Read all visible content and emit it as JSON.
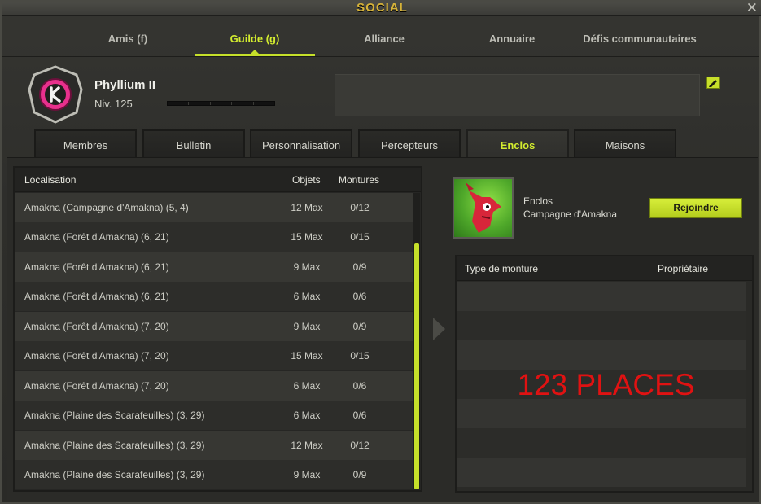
{
  "window": {
    "title": "SOCIAL",
    "close_label": "✕"
  },
  "top_tabs": [
    {
      "label": "Amis (f)"
    },
    {
      "label": "Guilde (g)"
    },
    {
      "label": "Alliance"
    },
    {
      "label": "Annuaire"
    },
    {
      "label": "Défis communautaires"
    }
  ],
  "active_top_tab": "Guilde (g)",
  "guild": {
    "name": "Phyllium II",
    "level": "Niv. 125",
    "emblem_color": "#e8308d"
  },
  "sub_tabs": [
    {
      "label": "Membres"
    },
    {
      "label": "Bulletin"
    },
    {
      "label": "Personnalisation"
    },
    {
      "label": "Percepteurs"
    },
    {
      "label": "Enclos"
    },
    {
      "label": "Maisons"
    }
  ],
  "active_sub_tab": "Enclos",
  "paddock_list": {
    "columns": {
      "location": "Localisation",
      "objects": "Objets",
      "mounts": "Montures"
    },
    "rows": [
      {
        "location": "Amakna (Campagne d'Amakna) (5, 4)",
        "objects": "12 Max",
        "mounts": "0/12"
      },
      {
        "location": "Amakna (Forêt d'Amakna) (6, 21)",
        "objects": "15 Max",
        "mounts": "0/15"
      },
      {
        "location": "Amakna (Forêt d'Amakna) (6, 21)",
        "objects": "9 Max",
        "mounts": "0/9"
      },
      {
        "location": "Amakna (Forêt d'Amakna) (6, 21)",
        "objects": "6 Max",
        "mounts": "0/6"
      },
      {
        "location": "Amakna (Forêt d'Amakna) (7, 20)",
        "objects": "9 Max",
        "mounts": "0/9"
      },
      {
        "location": "Amakna (Forêt d'Amakna) (7, 20)",
        "objects": "15 Max",
        "mounts": "0/15"
      },
      {
        "location": "Amakna (Forêt d'Amakna) (7, 20)",
        "objects": "6 Max",
        "mounts": "0/6"
      },
      {
        "location": "Amakna (Plaine des Scarafeuilles) (3, 29)",
        "objects": "6 Max",
        "mounts": "0/6"
      },
      {
        "location": "Amakna (Plaine des Scarafeuilles) (3, 29)",
        "objects": "12 Max",
        "mounts": "0/12"
      },
      {
        "location": "Amakna (Plaine des Scarafeuilles) (3, 29)",
        "objects": "9 Max",
        "mounts": "0/9"
      }
    ]
  },
  "paddock_detail": {
    "title": "Enclos",
    "subtitle": "Campagne d'Amakna",
    "join_label": "Rejoindre",
    "columns": {
      "mount_type": "Type de monture",
      "owner": "Propriétaire"
    },
    "overlay_text": "123 PLACES",
    "overlay_color": "#e01212"
  },
  "accent_color": "#c6e02a"
}
